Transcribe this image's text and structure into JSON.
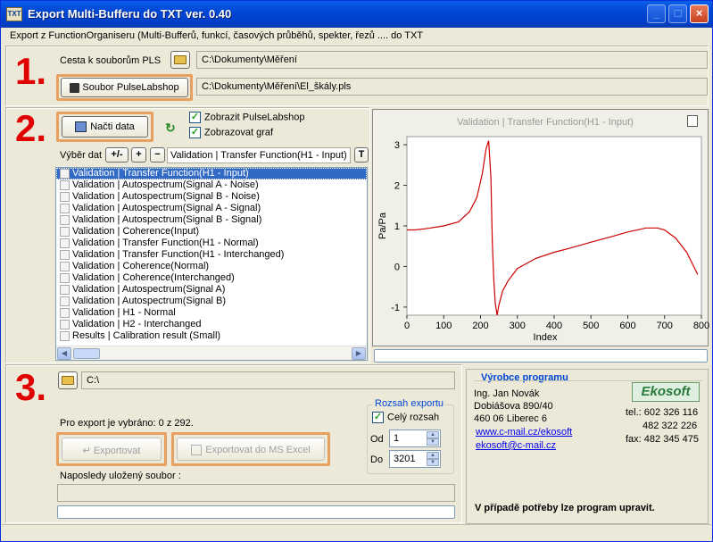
{
  "window": {
    "title": "Export Multi-Bufferu do TXT ver. 0.40",
    "icon_text": "TXT",
    "description": "Export z FunctionOrganiseru (Multi-Bufferů, funkcí, časových průběhů, spekter, řezů .... do TXT",
    "minimize_label": "_",
    "maximize_label": "□",
    "close_label": "×"
  },
  "section1": {
    "number": "1.",
    "path_label": "Cesta k souborům PLS",
    "path_value": "C:\\Dokumenty\\Měření",
    "file_button": "Soubor PulseLabshop",
    "file_value": "C:\\Dokumenty\\Měření\\El_škály.pls"
  },
  "section2": {
    "number": "2.",
    "load_button": "Načti data",
    "show_pulselabshop": "Zobrazit PulseLabshop",
    "show_graph": "Zobrazovat graf",
    "selection_label": "Výběr dat",
    "btn_plusminus": "+/-",
    "btn_plus": "+",
    "btn_minus": "−",
    "selected_value": "Validation | Transfer Function(H1 - Input)",
    "btn_t": "T",
    "items": [
      "Validation | Transfer Function(H1 - Input)",
      "Validation | Autospectrum(Signal A - Noise)",
      "Validation | Autospectrum(Signal B - Noise)",
      "Validation | Autospectrum(Signal A - Signal)",
      "Validation | Autospectrum(Signal B - Signal)",
      "Validation | Coherence(Input)",
      "Validation | Transfer Function(H1 - Normal)",
      "Validation | Transfer Function(H1 - Interchanged)",
      "Validation | Coherence(Normal)",
      "Validation | Coherence(Interchanged)",
      "Validation | Autospectrum(Signal A)",
      "Validation | Autospectrum(Signal B)",
      "Validation | H1 - Normal",
      "Validation | H2 - Interchanged",
      "Results | Calibration result (Small)"
    ]
  },
  "chart_data": {
    "type": "line",
    "title": "Validation | Transfer Function(H1 - Input)",
    "xlabel": "Index",
    "ylabel": "Pa/Pa",
    "xlim": [
      0,
      800
    ],
    "ylim": [
      -1.2,
      3.2
    ],
    "xticks": [
      "0",
      "100",
      "200",
      "300",
      "400",
      "500",
      "600",
      "700",
      "800"
    ],
    "yticks": [
      "-1",
      "0",
      "1",
      "2",
      "3"
    ],
    "series": [
      {
        "color": "#cc0000",
        "x": [
          0,
          20,
          50,
          100,
          140,
          170,
          190,
          205,
          215,
          222,
          228,
          232,
          236,
          240,
          245,
          250,
          260,
          275,
          300,
          350,
          400,
          450,
          500,
          550,
          600,
          650,
          680,
          700,
          730,
          760,
          790
        ],
        "y": [
          0.9,
          0.9,
          0.93,
          1.0,
          1.1,
          1.35,
          1.7,
          2.3,
          2.9,
          3.1,
          2.2,
          0.6,
          -0.3,
          -0.9,
          -1.2,
          -0.95,
          -0.6,
          -0.35,
          -0.05,
          0.2,
          0.35,
          0.47,
          0.6,
          0.72,
          0.85,
          0.95,
          0.95,
          0.9,
          0.7,
          0.35,
          -0.2
        ]
      }
    ]
  },
  "section3": {
    "number": "3.",
    "export_path": "C:\\",
    "selected_info": "Pro export je vybráno: 0 z 292.",
    "export_button": "Exportovat",
    "excel_button": "Exportovat do MS Excel",
    "last_saved_label": "Naposledy uložený soubor :",
    "range_title": "Rozsah exportu",
    "full_range": "Celý rozsah",
    "from_label": "Od",
    "from_value": "1",
    "to_label": "Do",
    "to_value": "3201"
  },
  "producer": {
    "title": "Výrobce programu",
    "name": "Ing. Jan Novák",
    "street": "Dobiášova 890/40",
    "city": "460 06  Liberec 6",
    "web": "www.c-mail.cz/ekosoft",
    "email": "ekosoft@c-mail.cz",
    "logo": "Ekosoft",
    "tel": "tel.: 602 326 116",
    "tel2": "482 322 226",
    "fax": "fax: 482 345 475",
    "note": "V případě potřeby lze program upravit."
  }
}
